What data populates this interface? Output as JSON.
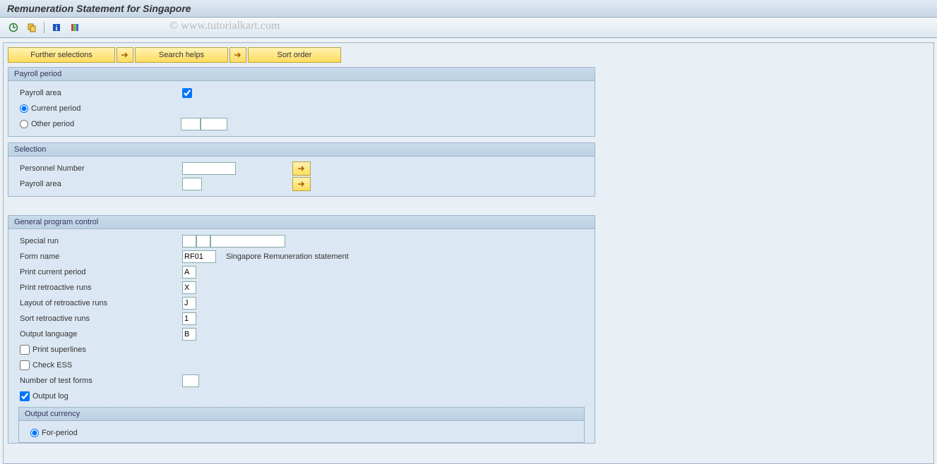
{
  "title": "Remuneration Statement for Singapore",
  "watermark": "© www.tutorialkart.com",
  "buttons": {
    "further_selections": "Further selections",
    "search_helps": "Search helps",
    "sort_order": "Sort order"
  },
  "payroll_period": {
    "title": "Payroll period",
    "area_label": "Payroll area",
    "area_value": "",
    "current_label": "Current period",
    "other_label": "Other period",
    "other_val1": "",
    "other_val2": ""
  },
  "selection": {
    "title": "Selection",
    "pernr_label": "Personnel Number",
    "pernr_value": "",
    "area_label": "Payroll area",
    "area_value": ""
  },
  "general": {
    "title": "General program control",
    "special_run_label": "Special run",
    "special_run_v1": "",
    "special_run_v2": "",
    "special_run_v3": "",
    "form_name_label": "Form name",
    "form_name_value": "RF01",
    "form_name_desc": "Singapore Remuneration statement",
    "print_current_label": "Print current period",
    "print_current_value": "A",
    "print_retro_label": "Print retroactive runs",
    "print_retro_value": "X",
    "layout_retro_label": "Layout of retroactive runs",
    "layout_retro_value": "J",
    "sort_retro_label": "Sort retroactive runs",
    "sort_retro_value": "1",
    "output_lang_label": "Output language",
    "output_lang_value": "B",
    "print_superlines_label": "Print superlines",
    "check_ess_label": "Check ESS",
    "num_test_label": "Number of test forms",
    "num_test_value": "",
    "output_log_label": "Output log",
    "output_currency": {
      "title": "Output currency",
      "for_period_label": "For-period"
    }
  }
}
